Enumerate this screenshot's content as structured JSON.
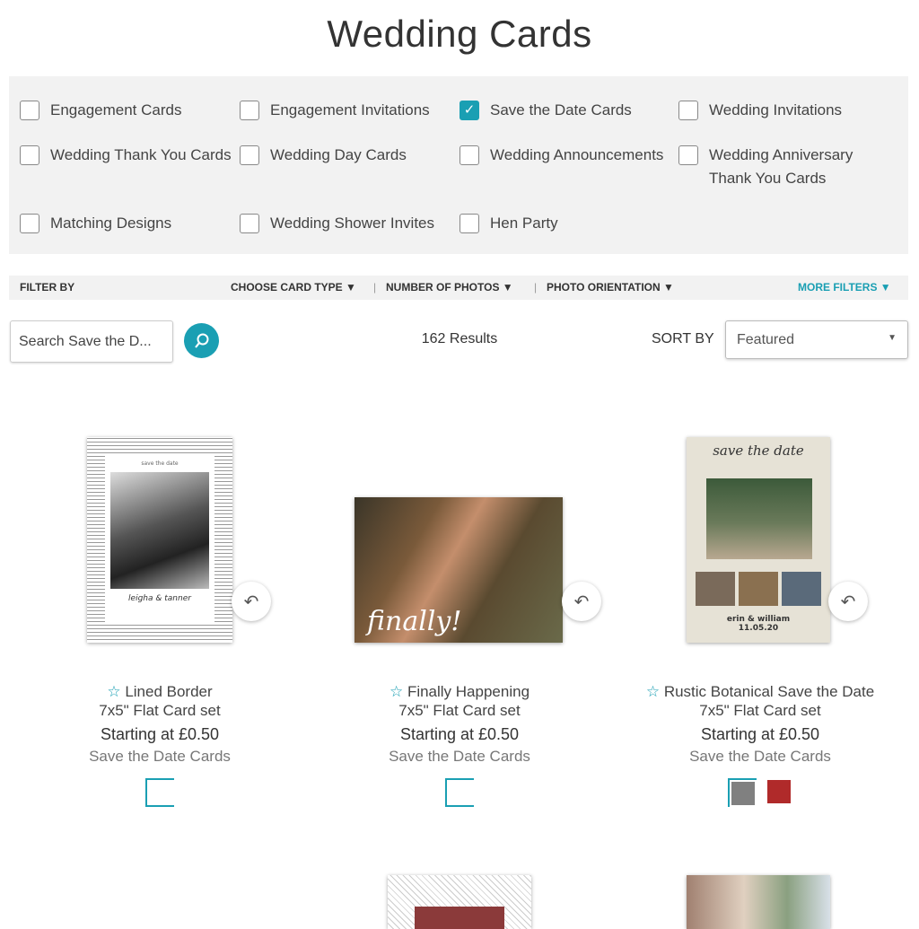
{
  "title": "Wedding Cards",
  "categories": [
    {
      "label": "Engagement Cards",
      "checked": false
    },
    {
      "label": "Engagement Invitations",
      "checked": false
    },
    {
      "label": "Save the Date Cards",
      "checked": true
    },
    {
      "label": "Wedding Invitations",
      "checked": false
    },
    {
      "label": "Wedding Thank You Cards",
      "checked": false
    },
    {
      "label": "Wedding Day Cards",
      "checked": false
    },
    {
      "label": "Wedding Announcements",
      "checked": false
    },
    {
      "label": "Wedding Anniversary Thank You Cards",
      "checked": false
    },
    {
      "label": "Matching Designs",
      "checked": false
    },
    {
      "label": "Wedding Shower Invites",
      "checked": false
    },
    {
      "label": "Hen Party",
      "checked": false
    }
  ],
  "filter": {
    "label": "FILTER BY",
    "card_type": "CHOOSE CARD TYPE",
    "photos": "NUMBER OF PHOTOS",
    "orientation": "PHOTO ORIENTATION",
    "more": "MORE FILTERS"
  },
  "search": {
    "value": "Search Save the D..."
  },
  "results": "162 Results",
  "sort": {
    "label": "SORT BY",
    "value": "Featured"
  },
  "products": [
    {
      "name": "Lined Border",
      "size": "7x5\" Flat Card set",
      "price": "Starting at £0.50",
      "category": "Save the Date Cards",
      "img_text": "save the date",
      "names": "leigha & tanner"
    },
    {
      "name": "Finally Happening",
      "size": "7x5\" Flat Card set",
      "price": "Starting at £0.50",
      "category": "Save the Date Cards",
      "img_text": "finally!"
    },
    {
      "name": "Rustic Botanical Save the Date",
      "size": "7x5\" Flat Card set",
      "price": "Starting at £0.50",
      "category": "Save the Date Cards",
      "img_text": "save the date",
      "names": "erin & william",
      "date": "11.05.20",
      "swatches": [
        "#808080",
        "#b02a2a"
      ]
    }
  ],
  "colors": {
    "accent": "#1a9fb3",
    "panel": "#f2f2f2"
  }
}
